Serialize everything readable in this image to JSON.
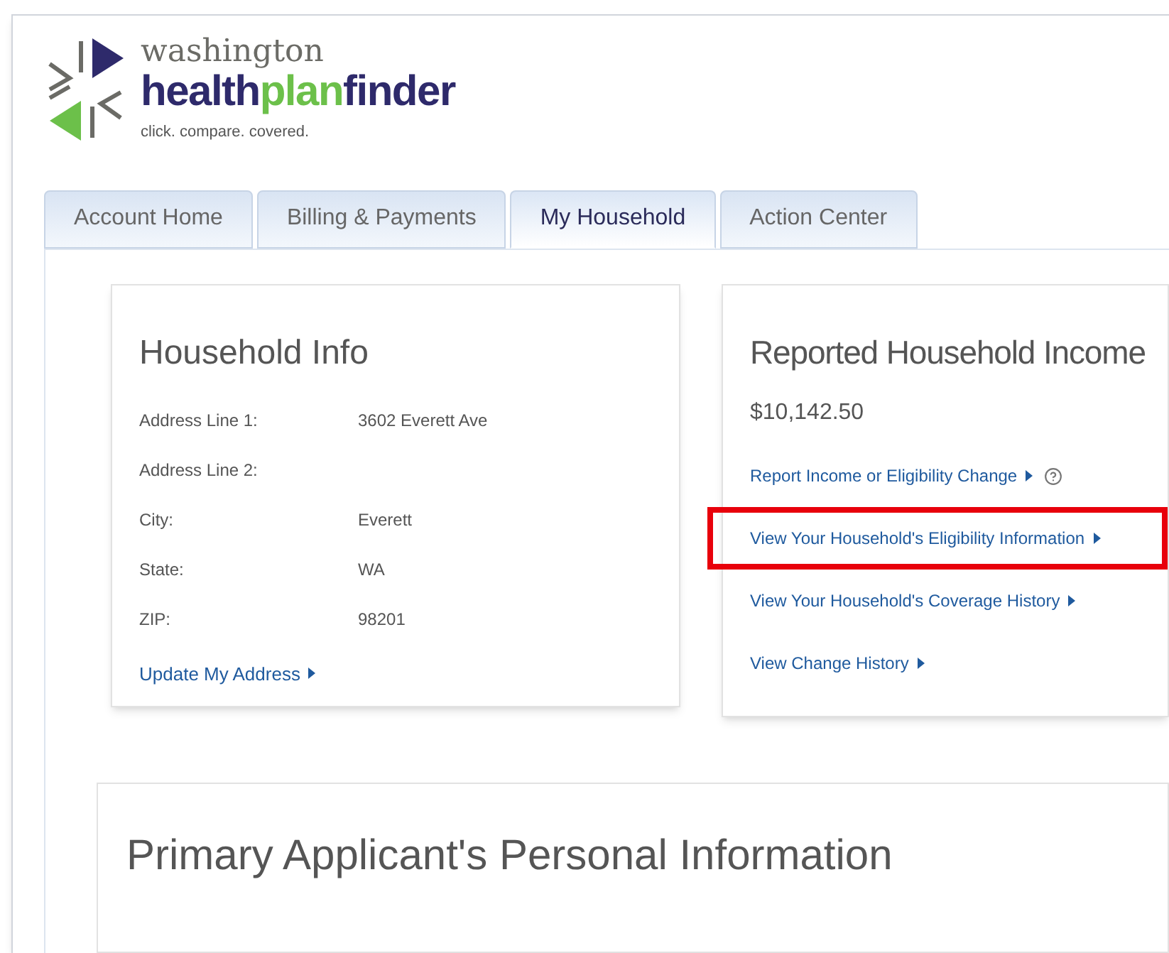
{
  "logo": {
    "top": "washington",
    "parts": [
      {
        "text": "health",
        "color": "#2e2a6b"
      },
      {
        "text": "plan",
        "color": "#6cc04a"
      },
      {
        "text": "finder",
        "color": "#2e2a6b"
      }
    ],
    "tagline": "click. compare. covered."
  },
  "tabs": [
    {
      "label": "Account Home",
      "selected": false
    },
    {
      "label": "Billing & Payments",
      "selected": false
    },
    {
      "label": "My Household",
      "selected": true
    },
    {
      "label": "Action Center",
      "selected": false
    }
  ],
  "household_info": {
    "title": "Household Info",
    "fields": [
      {
        "label": "Address Line 1:",
        "value": "3602 Everett Ave"
      },
      {
        "label": "Address Line 2:"
      },
      {
        "label": "City:",
        "value": "Everett"
      },
      {
        "label": "State:",
        "value": "WA"
      },
      {
        "label": "ZIP:",
        "value": "98201"
      }
    ],
    "link": "Update My Address"
  },
  "income": {
    "title": "Reported Household Income",
    "amount": "$10,142.50",
    "links": [
      {
        "label": "Report Income or Eligibility Change",
        "help": true,
        "highlighted": false
      },
      {
        "label": "View Your Household's Eligibility Information",
        "help": false,
        "highlighted": true
      },
      {
        "label": "View Your Household's Coverage History",
        "help": false,
        "highlighted": false
      },
      {
        "label": "View Change History",
        "help": false,
        "highlighted": false
      }
    ]
  },
  "personal_info": {
    "title": "Primary Applicant's Personal Information"
  }
}
